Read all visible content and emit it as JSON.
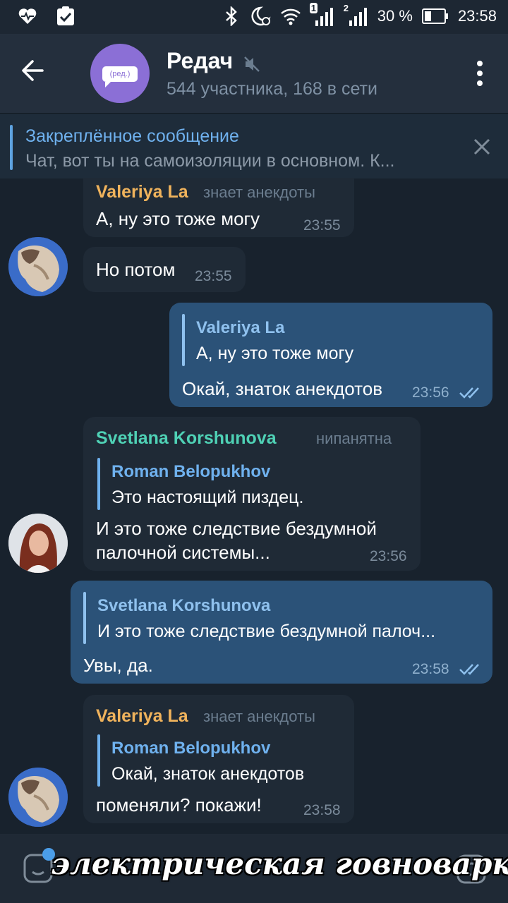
{
  "status": {
    "signal_sim1": "1",
    "signal_sim2": "2",
    "battery": "30 %",
    "time": "23:58"
  },
  "header": {
    "title": "Редач",
    "subtitle": "544 участника, 168 в сети",
    "avatar_label": "(ред.)"
  },
  "pinned": {
    "title": "Закреплённое сообщение",
    "text": "Чат, вот ты на самоизоляции в основном. К..."
  },
  "messages": [
    {
      "name": "Valeriya La",
      "rank": "знает анекдоты",
      "text": "А, ну это тоже могу",
      "time": "23:55"
    },
    {
      "text": "Но потом",
      "time": "23:55"
    },
    {
      "reply_name": "Valeriya La",
      "reply_text": "А, ну это тоже могу",
      "text": "Окай, знаток анекдотов",
      "time": "23:56"
    },
    {
      "name": "Svetlana Korshunova",
      "rank": "нипанятна",
      "reply_name": "Roman Belopukhov",
      "reply_text": "Это настоящий пиздец.",
      "text_line1": "И это тоже следствие бездумной",
      "text_line2": "палочной системы...",
      "time": "23:56"
    },
    {
      "reply_name": "Svetlana Korshunova",
      "reply_text": "И это тоже следствие бездумной палоч...",
      "text": "Увы, да.",
      "time": "23:58"
    },
    {
      "name": "Valeriya La",
      "rank": "знает анекдоты",
      "reply_name": "Roman Belopukhov",
      "reply_text": "Окай, знаток анекдотов",
      "text": "поменяли? покажи!",
      "time": "23:58"
    }
  ],
  "colors": {
    "valeriya": "#f0b35c",
    "svetlana": "#4fd1b5",
    "reply_name": "#6fb1ee"
  },
  "watermark": "электрическая говноварка"
}
